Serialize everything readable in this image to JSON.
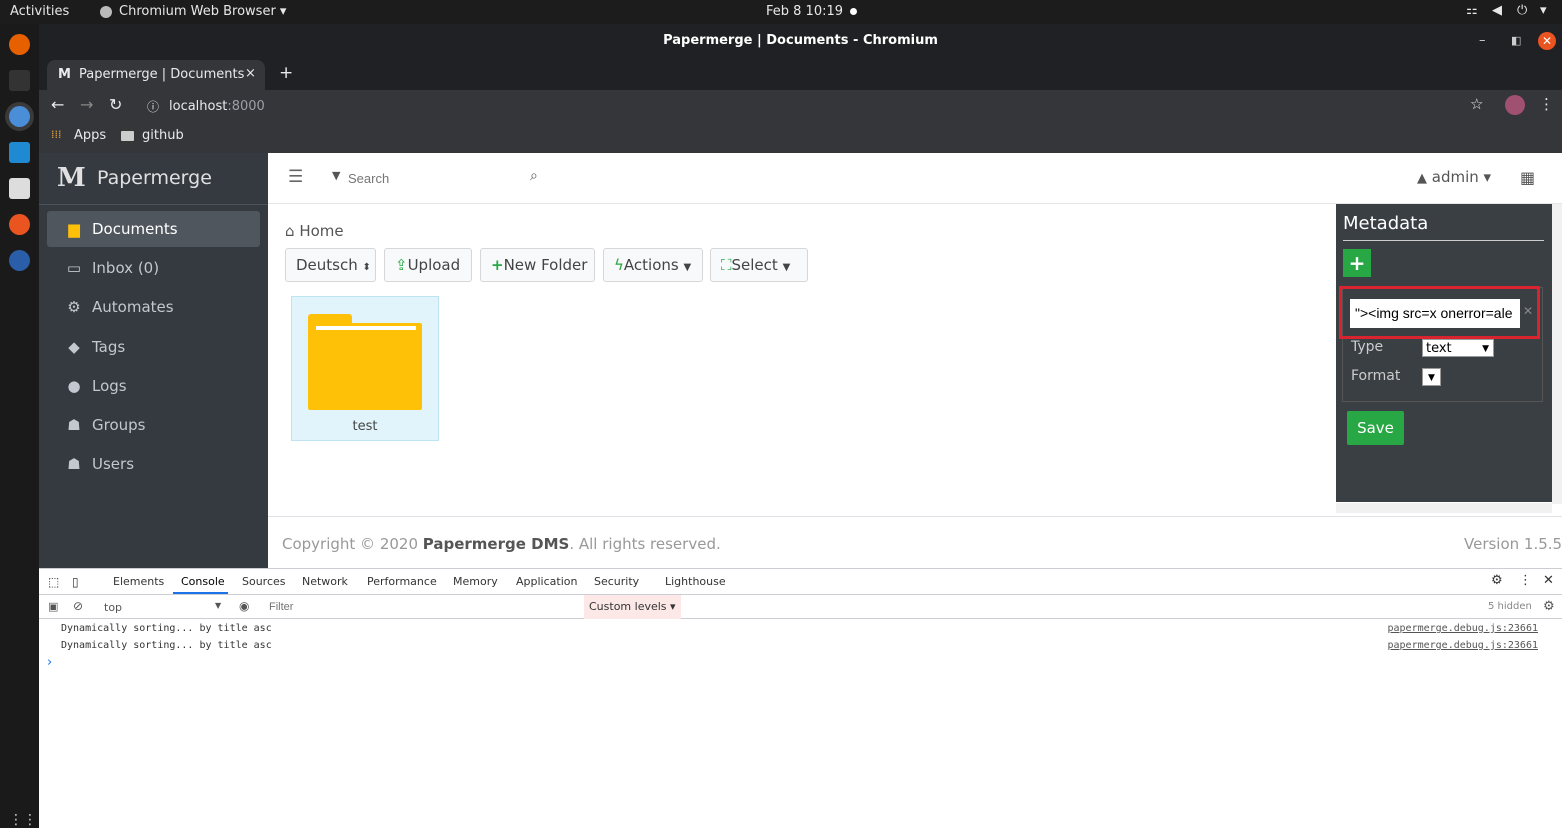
{
  "topbar": {
    "activities": "Activities",
    "app_name": "Chromium Web Browser",
    "clock": "Feb 8  10:19"
  },
  "window": {
    "title": "Papermerge | Documents - Chromium"
  },
  "tab": {
    "title": "Papermerge | Documents",
    "close": "×",
    "new_tab": "+"
  },
  "toolbar": {
    "url_host": "localhost",
    "url_port": ":8000"
  },
  "bookmarks": {
    "apps": "Apps",
    "github": "github"
  },
  "brand": {
    "name": "Papermerge"
  },
  "sidebar": {
    "items": [
      {
        "label": "Documents"
      },
      {
        "label": "Inbox (0)"
      },
      {
        "label": "Automates"
      },
      {
        "label": "Tags"
      },
      {
        "label": "Logs"
      },
      {
        "label": "Groups"
      },
      {
        "label": "Users"
      }
    ]
  },
  "navbar": {
    "search_placeholder": "Search",
    "user": "admin"
  },
  "breadcrumb": {
    "home": "Home"
  },
  "actions": {
    "language": "Deutsch",
    "upload": "Upload",
    "new_folder": "New Folder",
    "actions": "Actions",
    "select": "Select"
  },
  "folder": {
    "name": "test"
  },
  "metadata": {
    "title": "Metadata",
    "add": "+",
    "key_value": "\"><img src=x onerror=ale",
    "type_label": "Type",
    "type_value": "text",
    "format_label": "Format",
    "save": "Save"
  },
  "footer": {
    "copyright_prefix": "Copyright © 2020 ",
    "company": "Papermerge DMS",
    "suffix": ". All rights reserved.",
    "version": "Version 1.5.5"
  },
  "devtools": {
    "tabs": [
      "Elements",
      "Console",
      "Sources",
      "Network",
      "Performance",
      "Memory",
      "Application",
      "Security",
      "Lighthouse"
    ],
    "context": "top",
    "filter_placeholder": "Filter",
    "levels": "Custom levels ▾",
    "hidden": "5 hidden",
    "logs": [
      {
        "msg": "Dynamically sorting... by title asc",
        "src": "papermerge.debug.js:23661"
      },
      {
        "msg": "Dynamically sorting... by title asc",
        "src": "papermerge.debug.js:23661"
      }
    ],
    "prompt": "›"
  },
  "colors": {
    "accent_green": "#28a745",
    "sidebar": "#343a40",
    "folder": "#ffc107",
    "highlight": "#d9232f"
  }
}
